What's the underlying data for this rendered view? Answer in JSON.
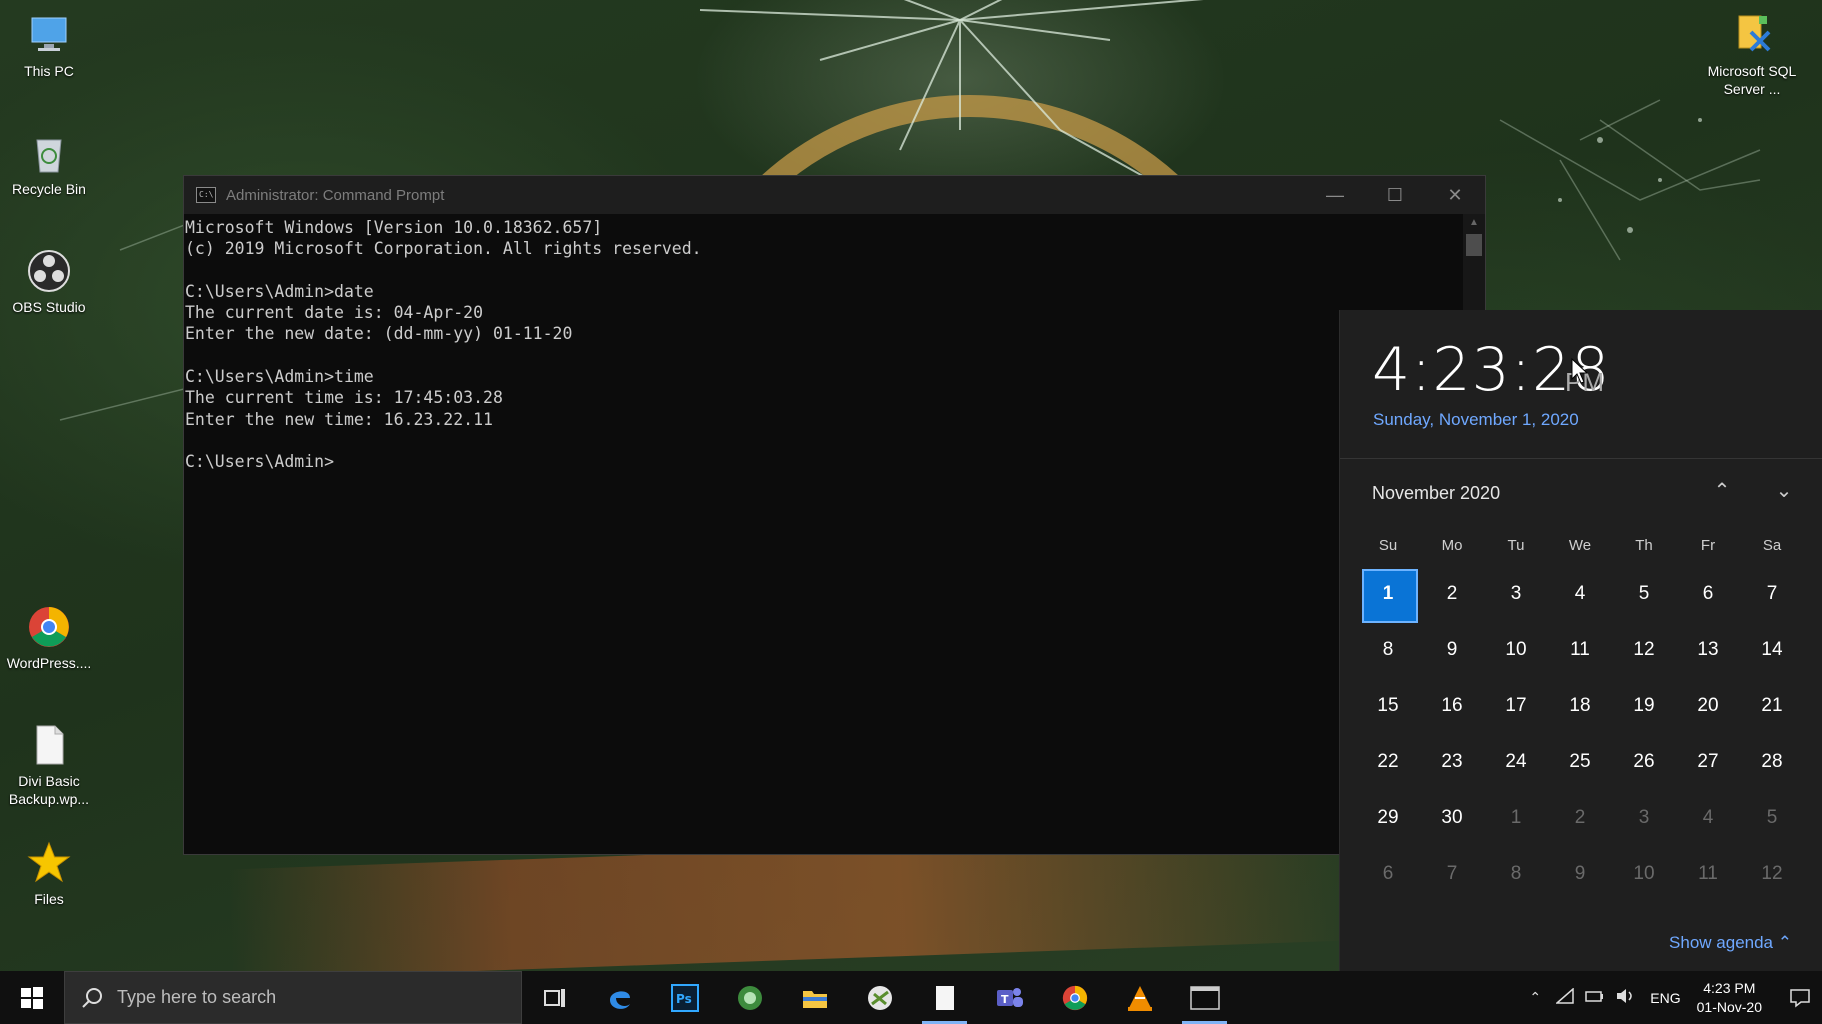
{
  "desktop": {
    "icons": [
      {
        "label": "This PC"
      },
      {
        "label": "Recycle Bin"
      },
      {
        "label": "OBS Studio"
      },
      {
        "label": "WordPress...."
      },
      {
        "label": "Divi Basic Backup.wp..."
      },
      {
        "label": "Files"
      },
      {
        "label": "Microsoft SQL Server ..."
      }
    ]
  },
  "cmd": {
    "title": "Administrator: Command Prompt",
    "lines": [
      "Microsoft Windows [Version 10.0.18362.657]",
      "(c) 2019 Microsoft Corporation. All rights reserved.",
      "",
      "C:\\Users\\Admin>date",
      "The current date is: 04-Apr-20",
      "Enter the new date: (dd-mm-yy) 01-11-20",
      "",
      "C:\\Users\\Admin>time",
      "The current time is: 17:45:03.28",
      "Enter the new time: 16.23.22.11",
      "",
      "C:\\Users\\Admin>"
    ]
  },
  "clock": {
    "time": "4:23:28",
    "ampm": "PM",
    "date": "Sunday, November 1, 2020"
  },
  "calendar": {
    "month_label": "November 2020",
    "weekdays": [
      "Su",
      "Mo",
      "Tu",
      "We",
      "Th",
      "Fr",
      "Sa"
    ],
    "days": [
      [
        "1",
        "2",
        "3",
        "4",
        "5",
        "6",
        "7"
      ],
      [
        "8",
        "9",
        "10",
        "11",
        "12",
        "13",
        "14"
      ],
      [
        "15",
        "16",
        "17",
        "18",
        "19",
        "20",
        "21"
      ],
      [
        "22",
        "23",
        "24",
        "25",
        "26",
        "27",
        "28"
      ],
      [
        "29",
        "30",
        "1",
        "2",
        "3",
        "4",
        "5"
      ],
      [
        "6",
        "7",
        "8",
        "9",
        "10",
        "11",
        "12"
      ]
    ],
    "show_agenda": "Show agenda",
    "accent": "#0a74d6"
  },
  "taskbar": {
    "search_placeholder": "Type here to search",
    "apps": [
      "task-view-icon",
      "edge-icon",
      "photoshop-icon",
      "android-studio-icon",
      "file-explorer-icon",
      "xampp-icon",
      "notepad-icon",
      "teams-icon",
      "chrome-icon",
      "vlc-icon",
      "command-prompt-icon"
    ],
    "tray": {
      "language": "ENG",
      "time": "4:23 PM",
      "date": "01-Nov-20"
    }
  }
}
